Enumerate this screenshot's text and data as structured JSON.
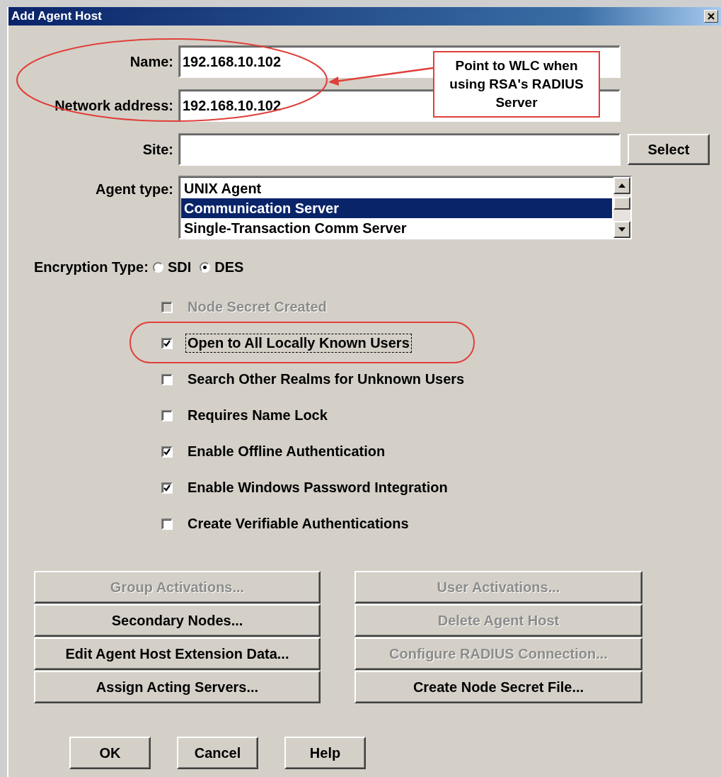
{
  "window": {
    "title": "Add Agent Host"
  },
  "fields": [
    {
      "label": "Name:",
      "value": "192.168.10.102"
    },
    {
      "label": "Network address:",
      "value": "192.168.10.102"
    },
    {
      "label": "Site:",
      "button": "Select"
    }
  ],
  "agent_type": {
    "label": "Agent type:",
    "items": [
      {
        "text": "UNIX Agent",
        "selected": false
      },
      {
        "text": "Communication Server",
        "selected": true
      },
      {
        "text": "Single-Transaction Comm Server",
        "selected": false
      }
    ]
  },
  "encryption": {
    "label": "Encryption Type:",
    "options": [
      {
        "label": "SDI",
        "selected": false
      },
      {
        "label": "DES",
        "selected": true
      }
    ]
  },
  "checkboxes": [
    {
      "label": "Node Secret Created",
      "checked": false,
      "disabled": true,
      "focused": false
    },
    {
      "label": "Open to All Locally Known Users",
      "checked": true,
      "disabled": false,
      "focused": true
    },
    {
      "label": "Search Other Realms for Unknown Users",
      "checked": false,
      "disabled": false,
      "focused": false
    },
    {
      "label": "Requires Name Lock",
      "checked": false,
      "disabled": false,
      "focused": false
    },
    {
      "label": "Enable Offline Authentication",
      "checked": true,
      "disabled": false,
      "focused": false
    },
    {
      "label": "Enable Windows Password Integration",
      "checked": true,
      "disabled": false,
      "focused": false
    },
    {
      "label": "Create Verifiable Authentications",
      "checked": false,
      "disabled": false,
      "focused": false
    }
  ],
  "action_buttons": [
    {
      "label": "Group Activations...",
      "disabled": true
    },
    {
      "label": "User Activations...",
      "disabled": true
    },
    {
      "label": "Secondary Nodes...",
      "disabled": false
    },
    {
      "label": "Delete Agent Host",
      "disabled": true
    },
    {
      "label": "Edit Agent Host Extension Data...",
      "disabled": false
    },
    {
      "label": "Configure RADIUS Connection...",
      "disabled": true
    },
    {
      "label": "Assign Acting Servers...",
      "disabled": false
    },
    {
      "label": "Create Node Secret File...",
      "disabled": false
    }
  ],
  "dialog_buttons": [
    "OK",
    "Cancel",
    "Help"
  ],
  "annotation": {
    "callout": "Point to WLC when using RSA's RADIUS Server"
  }
}
